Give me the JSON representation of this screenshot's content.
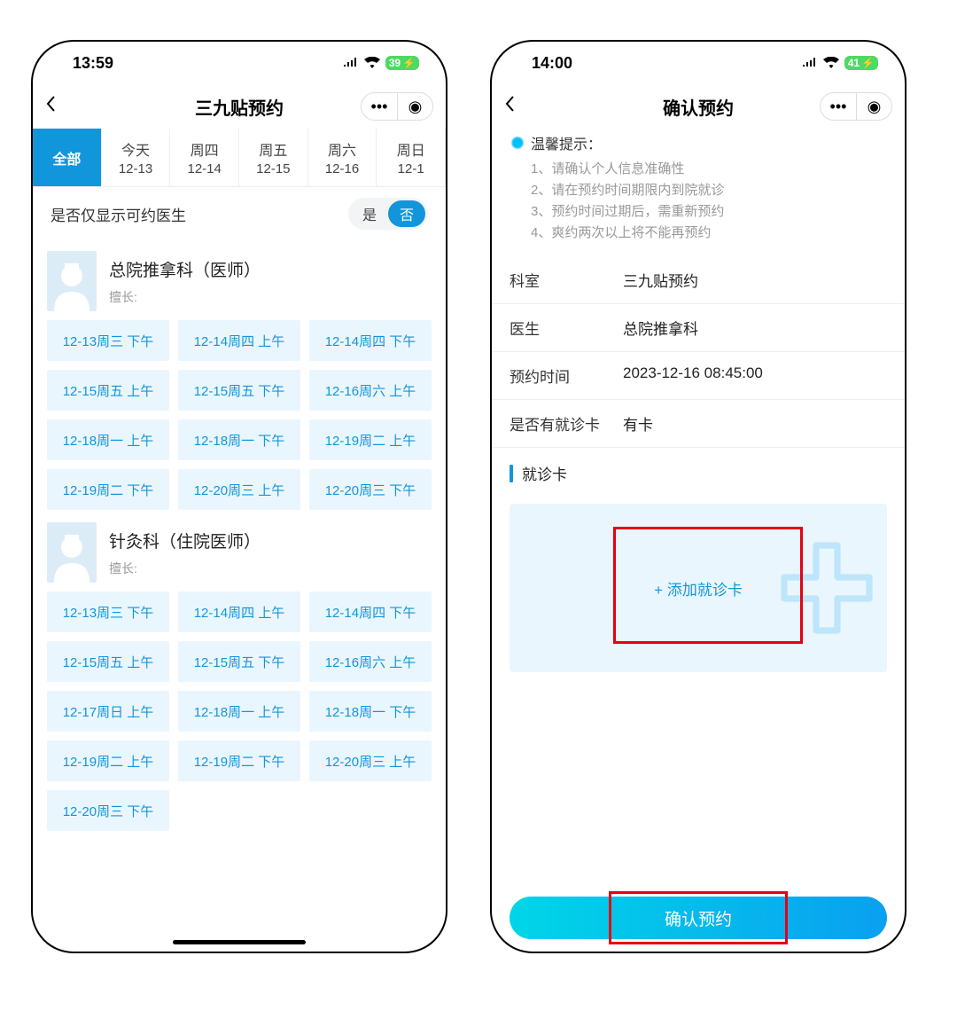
{
  "left": {
    "status_time": "13:59",
    "battery": "39",
    "nav_title": "三九贴预约",
    "tabs": [
      {
        "day": "全部",
        "date": "",
        "active": true
      },
      {
        "day": "今天",
        "date": "12-13"
      },
      {
        "day": "周四",
        "date": "12-14"
      },
      {
        "day": "周五",
        "date": "12-15"
      },
      {
        "day": "周六",
        "date": "12-16"
      },
      {
        "day": "周日",
        "date": "12-1"
      }
    ],
    "filter_label": "是否仅显示可约医生",
    "toggle_yes": "是",
    "toggle_no": "否",
    "doctors": [
      {
        "name": "总院推拿科（医师）",
        "sub": "擅长:",
        "slots": [
          "12-13周三 下午",
          "12-14周四 上午",
          "12-14周四 下午",
          "12-15周五 上午",
          "12-15周五 下午",
          "12-16周六 上午",
          "12-18周一 上午",
          "12-18周一 下午",
          "12-19周二 上午",
          "12-19周二 下午",
          "12-20周三 上午",
          "12-20周三 下午"
        ]
      },
      {
        "name": "针灸科（住院医师）",
        "sub": "擅长:",
        "slots": [
          "12-13周三 下午",
          "12-14周四 上午",
          "12-14周四 下午",
          "12-15周五 上午",
          "12-15周五 下午",
          "12-16周六 上午",
          "12-17周日 上午",
          "12-18周一 上午",
          "12-18周一 下午",
          "12-19周二 上午",
          "12-19周二 下午",
          "12-20周三 上午",
          "12-20周三 下午"
        ]
      }
    ]
  },
  "right": {
    "status_time": "14:00",
    "battery": "41",
    "nav_title": "确认预约",
    "tips_title": "温馨提示：",
    "tips": [
      "1、请确认个人信息准确性",
      "2、请在预约时间期限内到院就诊",
      "3、预约时间过期后，需重新预约",
      "4、爽约两次以上将不能再预约"
    ],
    "rows": [
      {
        "label": "科室",
        "value": "三九贴预约"
      },
      {
        "label": "医生",
        "value": "总院推拿科"
      },
      {
        "label": "预约时间",
        "value": "2023-12-16 08:45:00"
      },
      {
        "label": "是否有就诊卡",
        "value": "有卡"
      }
    ],
    "section_title": "就诊卡",
    "add_card": "+ 添加就诊卡",
    "confirm": "确认预约"
  }
}
